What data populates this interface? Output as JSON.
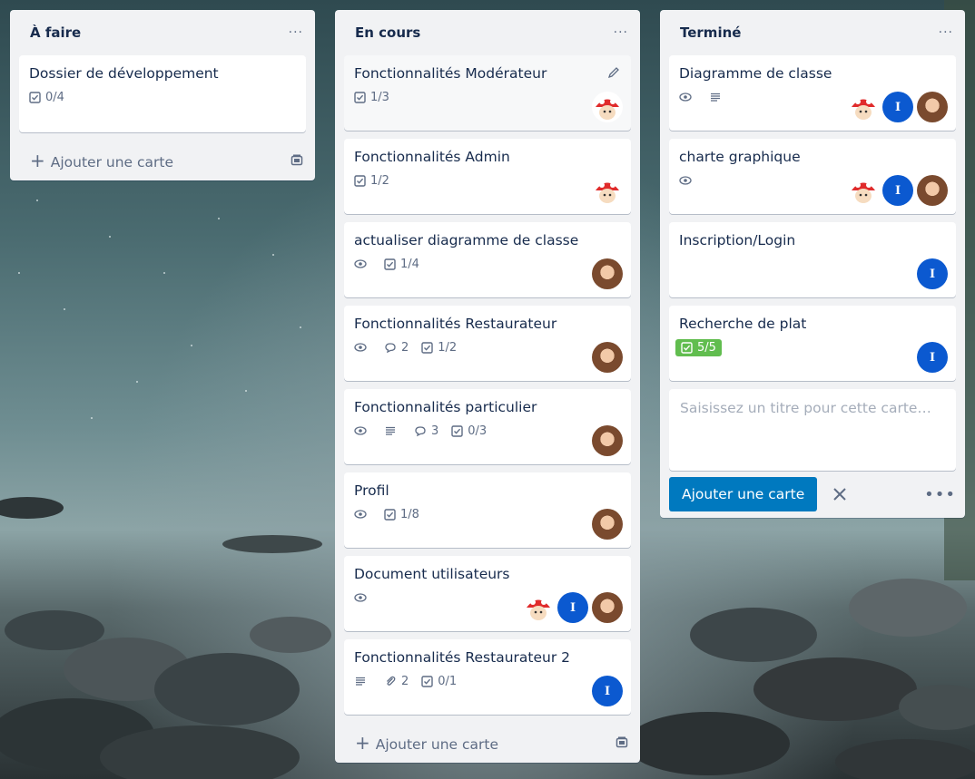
{
  "lists": [
    {
      "title": "À faire",
      "cards": [
        {
          "title": "Dossier de développement",
          "checklist": "0/4"
        }
      ],
      "add_label": "Ajouter une carte"
    },
    {
      "title": "En cours",
      "cards": [
        {
          "title": "Fonctionnalités Modérateur",
          "checklist": "1/3"
        },
        {
          "title": "Fonctionnalités Admin",
          "checklist": "1/2"
        },
        {
          "title": "actualiser diagramme de classe",
          "checklist": "1/4"
        },
        {
          "title": "Fonctionnalités Restaurateur",
          "comments": "2",
          "checklist": "1/2"
        },
        {
          "title": "Fonctionnalités particulier",
          "comments": "3",
          "checklist": "0/3"
        },
        {
          "title": "Profil",
          "checklist": "1/8"
        },
        {
          "title": "Document utilisateurs"
        },
        {
          "title": "Fonctionnalités Restaurateur 2",
          "attachments": "2",
          "checklist": "0/1"
        }
      ],
      "add_label": "Ajouter une carte"
    },
    {
      "title": "Terminé",
      "cards": [
        {
          "title": "Diagramme de classe"
        },
        {
          "title": "charte graphique"
        },
        {
          "title": "Inscription/Login"
        },
        {
          "title": "Recherche de plat",
          "checklist": "5/5"
        }
      ],
      "composer": {
        "placeholder": "Saisissez un titre pour cette carte…",
        "submit_label": "Ajouter une carte"
      }
    }
  ],
  "avatar_initial": "I",
  "colors": {
    "list_bg": "#f1f2f4",
    "primary_button": "#0079bf",
    "member_blue": "#0b59d0",
    "checklist_done": "#61bd4f"
  }
}
